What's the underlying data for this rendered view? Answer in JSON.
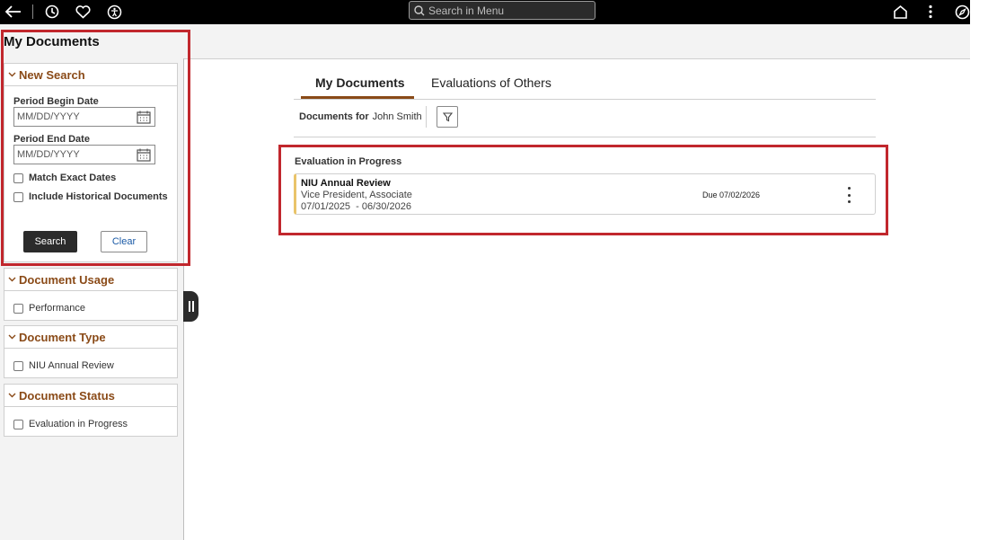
{
  "topbar": {
    "back_icon": "back-arrow-icon",
    "history_icon": "clock-icon",
    "favorites_icon": "heart-icon",
    "accessibility_icon": "accessibility-icon",
    "search_placeholder": "Search in Menu",
    "home_icon": "home-icon",
    "actions_icon": "vertical-ellipsis-icon",
    "navigator_icon": "compass-icon"
  },
  "page": {
    "title": "My Documents"
  },
  "left": {
    "new_search": {
      "heading": "New Search",
      "begin_label": "Period Begin Date",
      "begin_placeholder": "MM/DD/YYYY",
      "end_label": "Period End Date",
      "end_placeholder": "MM/DD/YYYY",
      "match_exact": "Match Exact Dates",
      "include_historical": "Include Historical Documents",
      "search_btn": "Search",
      "clear_btn": "Clear"
    },
    "filters": [
      {
        "heading": "Document Usage",
        "option": "Performance"
      },
      {
        "heading": "Document Type",
        "option": "NIU Annual Review"
      },
      {
        "heading": "Document Status",
        "option": "Evaluation in Progress"
      }
    ]
  },
  "main": {
    "tabs": [
      "My Documents",
      "Evaluations of Others"
    ],
    "active_tab": "My Documents",
    "docs_for_label": "Documents for",
    "docs_for_name": "John Smith",
    "section": "Evaluation in Progress",
    "document": {
      "title": "NIU Annual Review",
      "role": "Vice President, Associate",
      "period": "07/01/2025  - 06/30/2026",
      "due": "Due 07/02/2026"
    }
  },
  "colors": {
    "accent": "#8a4a17",
    "highlight": "#c1272d",
    "card_stripe": "#e9c46a",
    "topbar": "#000000"
  }
}
